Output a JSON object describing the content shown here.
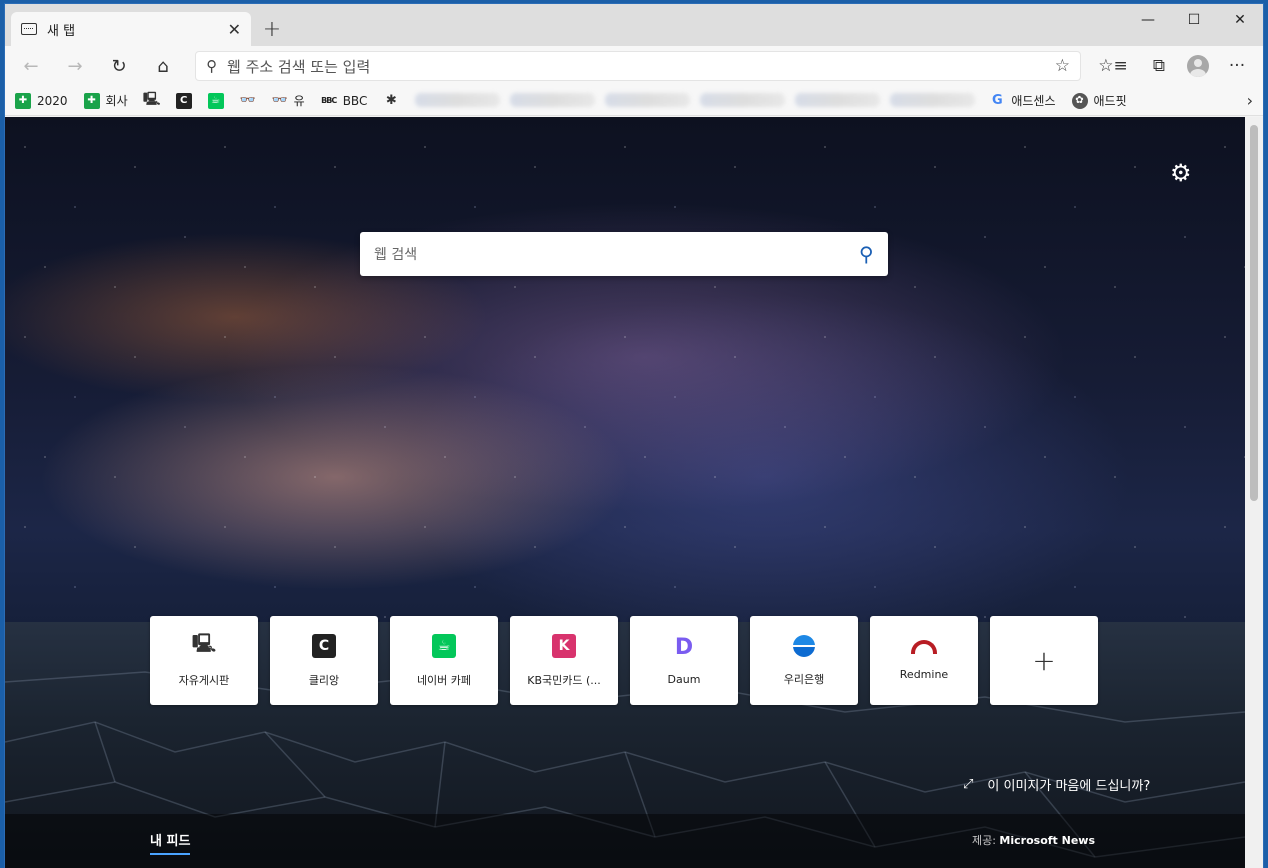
{
  "tab": {
    "title": "새 탭",
    "close": "✕",
    "new_tab": "+"
  },
  "window_controls": {
    "minimize": "—",
    "maximize": "☐",
    "close": "✕"
  },
  "toolbar": {
    "back": "←",
    "forward": "→",
    "refresh": "↻",
    "home": "⌂",
    "address_placeholder": "웹 주소 검색 또는 입력",
    "favorite": "☆",
    "favorites_list": "☆≡",
    "collections": "⧉",
    "more": "···"
  },
  "bookmarks": [
    {
      "label": "2020",
      "icon": "✚"
    },
    {
      "label": "회사",
      "icon": "✚"
    },
    {
      "label": "",
      "icon": "🖳"
    },
    {
      "label": "",
      "icon": "C"
    },
    {
      "label": "",
      "icon": "☕"
    },
    {
      "label": "",
      "icon": "👓"
    },
    {
      "label": "유",
      "icon": "👓"
    },
    {
      "label": "BBC",
      "icon": "BBC"
    },
    {
      "label": "",
      "icon": "✱"
    },
    {
      "label": "애드센스",
      "icon": "G"
    },
    {
      "label": "애드핏",
      "icon": "✿"
    }
  ],
  "bookmarks_more": "›",
  "newtab": {
    "settings_icon": "⚙",
    "search_placeholder": "웹 검색",
    "search_icon": "⚲",
    "tiles": [
      {
        "label": "자유게시판",
        "icon": "🖳"
      },
      {
        "label": "클리앙",
        "icon": "C"
      },
      {
        "label": "네이버 카페",
        "icon": "☕"
      },
      {
        "label": "KB국민카드 (...",
        "icon": "K"
      },
      {
        "label": "Daum",
        "icon": "D"
      },
      {
        "label": "우리은행",
        "icon": ""
      },
      {
        "label": "Redmine",
        "icon": ""
      }
    ],
    "add_tile": "+",
    "like_image_icon": "⤢",
    "like_image": "이 이미지가 마음에 드십니까?",
    "feed_tab": "내 피드",
    "provider_prefix": "제공: ",
    "provider_name": "Microsoft News"
  }
}
